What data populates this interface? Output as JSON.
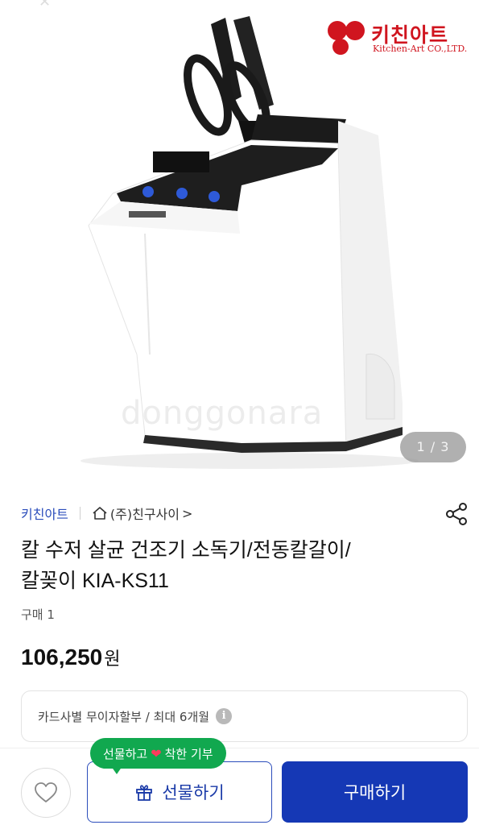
{
  "gallery": {
    "brand_logo_ko": "키친아트",
    "brand_logo_en": "Kitchen-Art CO.,LTD.",
    "watermark": "donggonara",
    "page_indicator": "1 / 3"
  },
  "product": {
    "seller": "키친아트",
    "store": "(주)친구사이",
    "store_chevron": ">",
    "title_line1": "칼 수저 살균 건조기 소독기/전동칼갈이/",
    "title_line2": "칼꽂이 KIA-KS11",
    "purchase_count": "구매 1",
    "price": "106,250",
    "currency": "원",
    "installment": "카드사별 무이자할부 / 최대 6개월",
    "info_icon": "i"
  },
  "bottom_bar": {
    "tooltip_left": "선물하고",
    "tooltip_heart": "❤",
    "tooltip_right": "착한 기부",
    "gift_label": "선물하기",
    "buy_label": "구매하기"
  },
  "icons": {
    "home": "home-icon",
    "share": "share-icon",
    "heart": "heart-outline-icon",
    "gift": "gift-icon",
    "info": "info-icon"
  },
  "colors": {
    "accent_blue": "#1538b5",
    "link_blue": "#2b4dbb",
    "tooltip_green": "#11a84f",
    "brand_red": "#d0151f"
  }
}
